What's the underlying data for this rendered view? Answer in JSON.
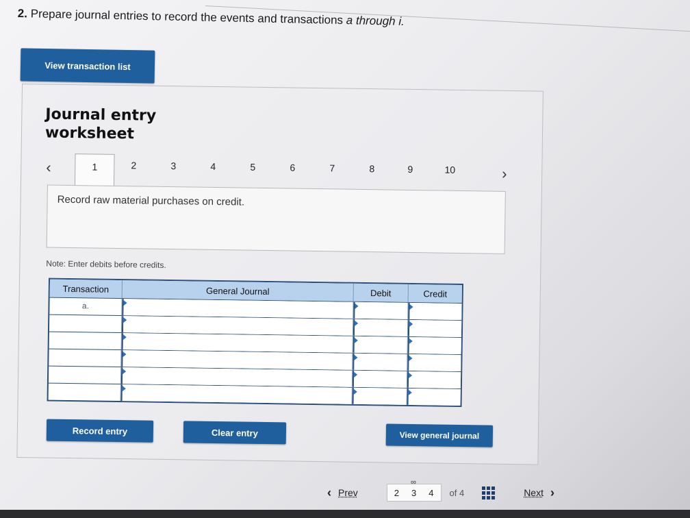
{
  "question": {
    "number": "2.",
    "text": "Prepare journal entries to record the events and transactions",
    "range": "a through i."
  },
  "buttons": {
    "view_transaction_list": "View transaction list",
    "record_entry": "Record entry",
    "clear_entry": "Clear entry",
    "view_general_journal": "View general journal"
  },
  "worksheet": {
    "title": "Journal entry worksheet",
    "tabs": [
      "1",
      "2",
      "3",
      "4",
      "5",
      "6",
      "7",
      "8",
      "9",
      "10"
    ],
    "active_tab": "1",
    "description": "Record raw material purchases on credit.",
    "note": "Note: Enter debits before credits."
  },
  "journal": {
    "headers": [
      "Transaction",
      "General Journal",
      "Debit",
      "Credit"
    ],
    "rows": [
      {
        "transaction": "a.",
        "account": "",
        "debit": "",
        "credit": ""
      },
      {
        "transaction": "",
        "account": "",
        "debit": "",
        "credit": ""
      },
      {
        "transaction": "",
        "account": "",
        "debit": "",
        "credit": ""
      },
      {
        "transaction": "",
        "account": "",
        "debit": "",
        "credit": ""
      },
      {
        "transaction": "",
        "account": "",
        "debit": "",
        "credit": ""
      },
      {
        "transaction": "",
        "account": "",
        "debit": "",
        "credit": ""
      }
    ]
  },
  "pager": {
    "prev": "Prev",
    "next": "Next",
    "pages": [
      "2",
      "3",
      "4"
    ],
    "current": "3",
    "of": "of 4"
  },
  "colors": {
    "button": "#1f5f9e",
    "table_header": "#b8d2ee",
    "table_border": "#2a4f7a"
  }
}
